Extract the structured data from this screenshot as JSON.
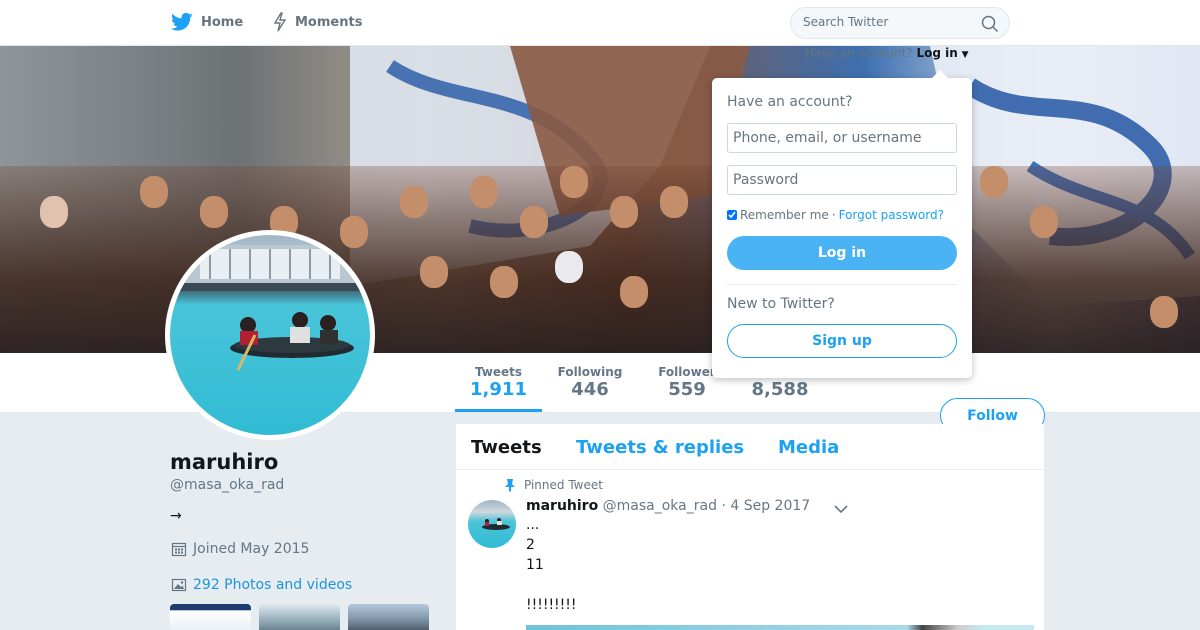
{
  "nav": {
    "home_label": "Home",
    "moments_label": "Moments",
    "search_placeholder": "Search Twitter",
    "login_prompt": "Have an account?",
    "login_link": "Log in"
  },
  "profile": {
    "name": "maruhiro",
    "handle": "@masa_oka_rad",
    "bio": "→",
    "joined": "Joined May 2015",
    "photos_link": "292 Photos and videos",
    "follow_button": "Follow"
  },
  "stats": [
    {
      "label": "Tweets",
      "value": "1,911"
    },
    {
      "label": "Following",
      "value": "446"
    },
    {
      "label": "Follower",
      "value": "559"
    },
    {
      "label": "",
      "value": "8,588"
    }
  ],
  "timeline": {
    "tabs": [
      "Tweets",
      "Tweets & replies",
      "Media"
    ],
    "pinned_label": "Pinned Tweet",
    "tweet": {
      "name": "maruhiro",
      "handle": "@masa_oka_rad",
      "date": "· 4 Sep 2017",
      "lines": [
        "...",
        "2",
        "11",
        "",
        "!!!!!!!!!"
      ]
    }
  },
  "login_dropdown": {
    "title": "Have an account?",
    "username_placeholder": "Phone, email, or username",
    "password_placeholder": "Password",
    "remember_label": "Remember me",
    "separator": "·",
    "forgot_link": "Forgot password?",
    "login_button": "Log in",
    "new_prompt": "New to Twitter?",
    "signup_button": "Sign up"
  },
  "colors": {
    "accent": "#1da1f2",
    "login_button_bg": "#4ab3f4",
    "page_bg": "#e6ecf0"
  }
}
